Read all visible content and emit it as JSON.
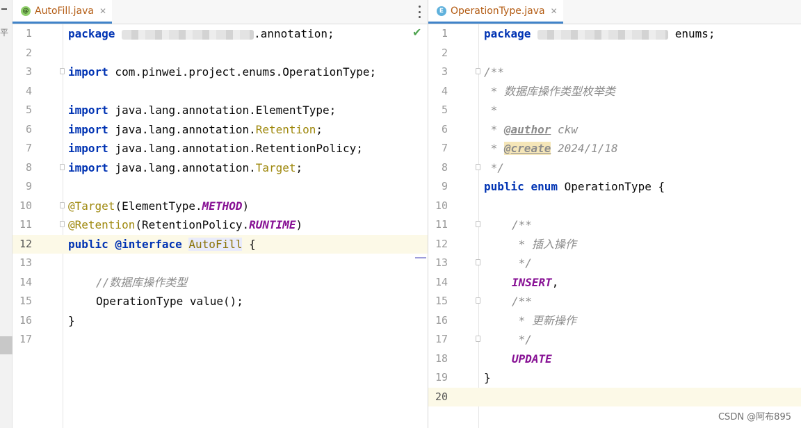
{
  "left_tab": {
    "label": "AutoFill.java",
    "icon": "annotation-file-icon",
    "icon_glyph": "@",
    "close_glyph": "✕"
  },
  "right_tab": {
    "label": "OperationType.java",
    "icon": "enum-file-icon",
    "icon_glyph": "E",
    "close_glyph": "✕"
  },
  "left_strip_glyph": "平",
  "left_line_numbers": [
    "1",
    "2",
    "3",
    "4",
    "5",
    "6",
    "7",
    "8",
    "9",
    "10",
    "11",
    "12",
    "13",
    "14",
    "15",
    "16",
    "17"
  ],
  "right_line_numbers": [
    "1",
    "2",
    "3",
    "4",
    "5",
    "6",
    "7",
    "8",
    "9",
    "10",
    "11",
    "12",
    "13",
    "14",
    "15",
    "16",
    "17",
    "18",
    "19",
    "20"
  ],
  "left_code": {
    "l1_kw": "package",
    "l1_tail": ".annotation;",
    "l3_kw": "import",
    "l3_rest": " com.pinwei.project.enums.OperationType;",
    "l5_kw": "import",
    "l5_rest": " java.lang.annotation.ElementType;",
    "l6_kw": "import",
    "l6_rest": " java.lang.annotation.",
    "l6_name": "Retention",
    "l6_end": ";",
    "l7_kw": "import",
    "l7_rest": " java.lang.annotation.RetentionPolicy;",
    "l8_kw": "import",
    "l8_rest": " java.lang.annotation.",
    "l8_name": "Target",
    "l8_end": ";",
    "l10_ann": "@Target",
    "l10_open": "(ElementType.",
    "l10_const": "METHOD",
    "l10_close": ")",
    "l11_ann": "@Retention",
    "l11_open": "(RetentionPolicy.",
    "l11_const": "RUNTIME",
    "l11_close": ")",
    "l12_kw1": "public",
    "l12_kw2": "@interface",
    "l12_name": "AutoFill",
    "l12_brace": " {",
    "l14_comment": "//数据库操作类型",
    "l15_code": "OperationType value();",
    "l16_code": "}"
  },
  "right_code": {
    "l1_kw": "package",
    "l1_tail": "enums;",
    "l3": "/**",
    "l4": " * 数据库操作类型枚举类",
    "l5": " *",
    "l6_star": " * ",
    "l6_tag": "@author",
    "l6_val": " ckw",
    "l7_star": " * ",
    "l7_tag": "@create",
    "l7_val": " 2024/1/18",
    "l8": " */",
    "l9_kw1": "public",
    "l9_kw2": "enum",
    "l9_rest": " OperationType {",
    "l11": "/**",
    "l12": " * 插入操作",
    "l13": " */",
    "l14_const": "INSERT",
    "l14_end": ",",
    "l15": "/**",
    "l16": " * 更新操作",
    "l17": " */",
    "l18_const": "UPDATE",
    "l19": "}"
  },
  "watermark": "CSDN @阿布895",
  "colors": {
    "keyword": "#0033b3",
    "annotation": "#9e880d",
    "constant": "#871094",
    "comment": "#8c8c8c",
    "current_line": "#fcf9e7",
    "tab_underline": "#4083c9",
    "check": "#4ea34f"
  }
}
